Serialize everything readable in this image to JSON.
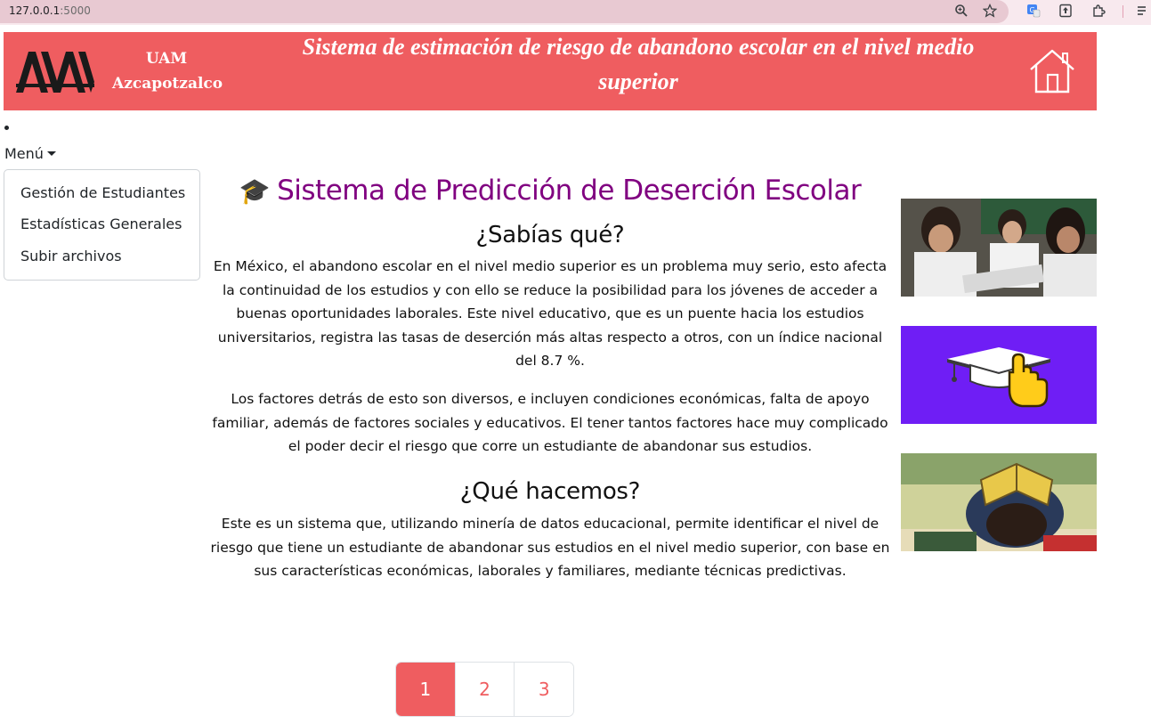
{
  "browser": {
    "url_host": "127.0.0.1",
    "url_port": ":5000"
  },
  "header": {
    "org_line1": "UAM",
    "org_line2": "Azcapotzalco",
    "title": "Sistema de estimación de riesgo de abandono escolar en el nivel medio superior",
    "home_icon": "home-icon"
  },
  "menu": {
    "toggle_label": "Menú",
    "items": [
      {
        "label": "Gestión de Estudiantes"
      },
      {
        "label": "Estadísticas Generales"
      },
      {
        "label": "Subir archivos"
      }
    ]
  },
  "main": {
    "title_icon": "🎓",
    "title": "Sistema de Predicción de Deserción Escolar",
    "section1_heading": "¿Sabías qué?",
    "section1_p1": "En México, el abandono escolar en el nivel medio superior es un problema muy serio, esto afecta la continuidad de los estudios y con ello se reduce la posibilidad para los jóvenes de acceder a buenas oportunidades laborales. Este nivel educativo, que es un puente hacia los estudios universitarios, registra las tasas de deserción más altas respecto a otros, con un índice nacional del 8.7 %.",
    "section1_p2": "Los factores detrás de esto son diversos, e incluyen condiciones económicas, falta de apoyo familiar, además de factores sociales y educativos. El tener tantos factores hace muy complicado el poder decir el riesgo que corre un estudiante de abandonar sus estudios.",
    "section2_heading": "¿Qué hacemos?",
    "section2_p1": "Este es un sistema que, utilizando minería de datos educacional, permite identificar el nivel de riesgo que tiene un estudiante de abandonar sus estudios en el nivel medio superior, con base en sus características económicas, laborales y familiares, mediante técnicas predictivas."
  },
  "pagination": {
    "pages": [
      "1",
      "2",
      "3"
    ],
    "active": "1"
  },
  "colors": {
    "brand": "#ef5d60",
    "title_purple": "#800080",
    "image2_bg": "#6f1ef5"
  }
}
